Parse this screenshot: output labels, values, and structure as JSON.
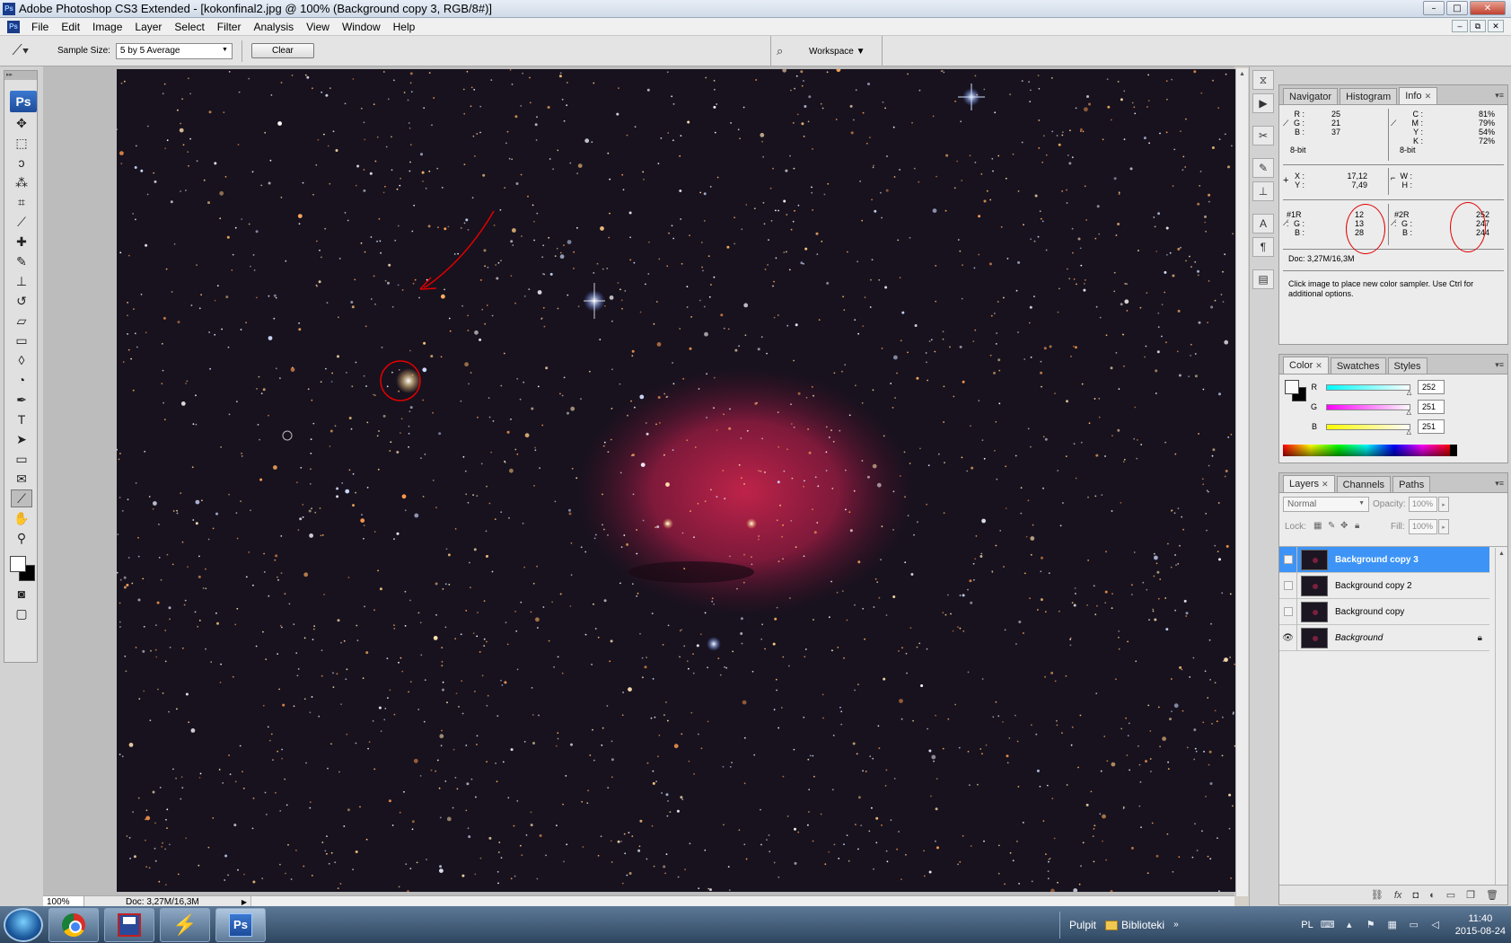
{
  "window": {
    "title": "Adobe Photoshop CS3 Extended - [kokonfinal2.jpg @ 100% (Background copy 3, RGB/8#)]",
    "app_icon": "Ps",
    "controls": [
      "–",
      "□",
      "✕"
    ]
  },
  "menubar": {
    "items": [
      "File",
      "Edit",
      "Image",
      "Layer",
      "Select",
      "Filter",
      "Analysis",
      "View",
      "Window",
      "Help"
    ],
    "doc_controls": [
      "–",
      "⧉",
      "✕"
    ]
  },
  "options": {
    "tool_icon": "eyedropper-icon",
    "sample_size_label": "Sample Size:",
    "sample_size_value": "5 by 5 Average",
    "clear_label": "Clear",
    "workspace_label": "Workspace ▼"
  },
  "toolbox": {
    "logo": "Ps",
    "tools": [
      {
        "name": "move-tool-icon",
        "glyph": "✥"
      },
      {
        "name": "marquee-tool-icon",
        "glyph": "⬚"
      },
      {
        "name": "lasso-tool-icon",
        "glyph": "ↄ"
      },
      {
        "name": "magic-wand-tool-icon",
        "glyph": "⁂"
      },
      {
        "name": "crop-tool-icon",
        "glyph": "⌗"
      },
      {
        "name": "eyedropper-tool-icon",
        "glyph": "⟋"
      },
      {
        "name": "healing-brush-tool-icon",
        "glyph": "✚"
      },
      {
        "name": "brush-tool-icon",
        "glyph": "✎"
      },
      {
        "name": "clone-stamp-tool-icon",
        "glyph": "⊥"
      },
      {
        "name": "history-brush-tool-icon",
        "glyph": "↺"
      },
      {
        "name": "eraser-tool-icon",
        "glyph": "▱"
      },
      {
        "name": "gradient-tool-icon",
        "glyph": "▭"
      },
      {
        "name": "blur-tool-icon",
        "glyph": "◊"
      },
      {
        "name": "dodge-tool-icon",
        "glyph": "◔"
      },
      {
        "name": "pen-tool-icon",
        "glyph": "✒"
      },
      {
        "name": "type-tool-icon",
        "glyph": "T"
      },
      {
        "name": "path-selection-tool-icon",
        "glyph": "➤"
      },
      {
        "name": "rectangle-tool-icon",
        "glyph": "▭"
      },
      {
        "name": "notes-tool-icon",
        "glyph": "✉"
      },
      {
        "name": "color-sampler-tool-icon",
        "glyph": "⟋"
      },
      {
        "name": "hand-tool-icon",
        "glyph": "✋"
      },
      {
        "name": "zoom-tool-icon",
        "glyph": "⚲"
      }
    ],
    "active_tool_index": 19
  },
  "status": {
    "zoom": "100%",
    "doc": "Doc: 3,27M/16,3M"
  },
  "info_panel": {
    "tabs": [
      "Navigator",
      "Histogram",
      "Info"
    ],
    "active_tab": "Info",
    "rgb": {
      "R": "25",
      "G": "21",
      "B": "37"
    },
    "cmyk": {
      "C": "81%",
      "M": "79%",
      "Y": "54%",
      "K": "72%"
    },
    "bit_left": "8-bit",
    "bit_right": "8-bit",
    "xy": {
      "X": "17,12",
      "Y": "7,49"
    },
    "wh": {
      "W": "",
      "H": ""
    },
    "sampler1": {
      "label_r": "#1R :",
      "R": "12",
      "G": "13",
      "B": "28"
    },
    "sampler2": {
      "label_r": "#2R :",
      "R": "252",
      "G": "247",
      "B": "244"
    },
    "doc": "Doc: 3,27M/16,3M",
    "hint": "Click image to place new color sampler.  Use Ctrl for additional options."
  },
  "color_panel": {
    "tabs": [
      "Color",
      "Swatches",
      "Styles"
    ],
    "active_tab": "Color",
    "R": {
      "label": "R",
      "value": "252",
      "level": 252
    },
    "G": {
      "label": "G",
      "value": "251",
      "level": 251
    },
    "B": {
      "label": "B",
      "value": "251",
      "level": 251
    }
  },
  "layers_panel": {
    "tabs": [
      "Layers",
      "Channels",
      "Paths"
    ],
    "active_tab": "Layers",
    "blend_mode": "Normal",
    "opacity_label": "Opacity:",
    "opacity_value": "100%",
    "lock_label": "Lock:",
    "fill_label": "Fill:",
    "fill_value": "100%",
    "layers": [
      {
        "name": "Background copy 3",
        "selected": true,
        "visible": false,
        "locked": false,
        "italic": false
      },
      {
        "name": "Background copy 2",
        "selected": false,
        "visible": false,
        "locked": false,
        "italic": false
      },
      {
        "name": "Background copy",
        "selected": false,
        "visible": false,
        "locked": false,
        "italic": false
      },
      {
        "name": "Background",
        "selected": false,
        "visible": true,
        "locked": true,
        "italic": true
      }
    ],
    "footer_icons": [
      "link-layers-icon",
      "fx-icon",
      "layer-mask-icon",
      "adjustment-layer-icon",
      "new-group-icon",
      "new-layer-icon",
      "delete-layer-icon"
    ]
  },
  "taskbar": {
    "apps": [
      "chrome",
      "save",
      "bolt",
      "photoshop"
    ],
    "ps_label": "Ps",
    "folder1": "Pulpit",
    "folder2": "Biblioteki",
    "lang": "PL",
    "time": "11:40",
    "date": "2015-08-24"
  }
}
